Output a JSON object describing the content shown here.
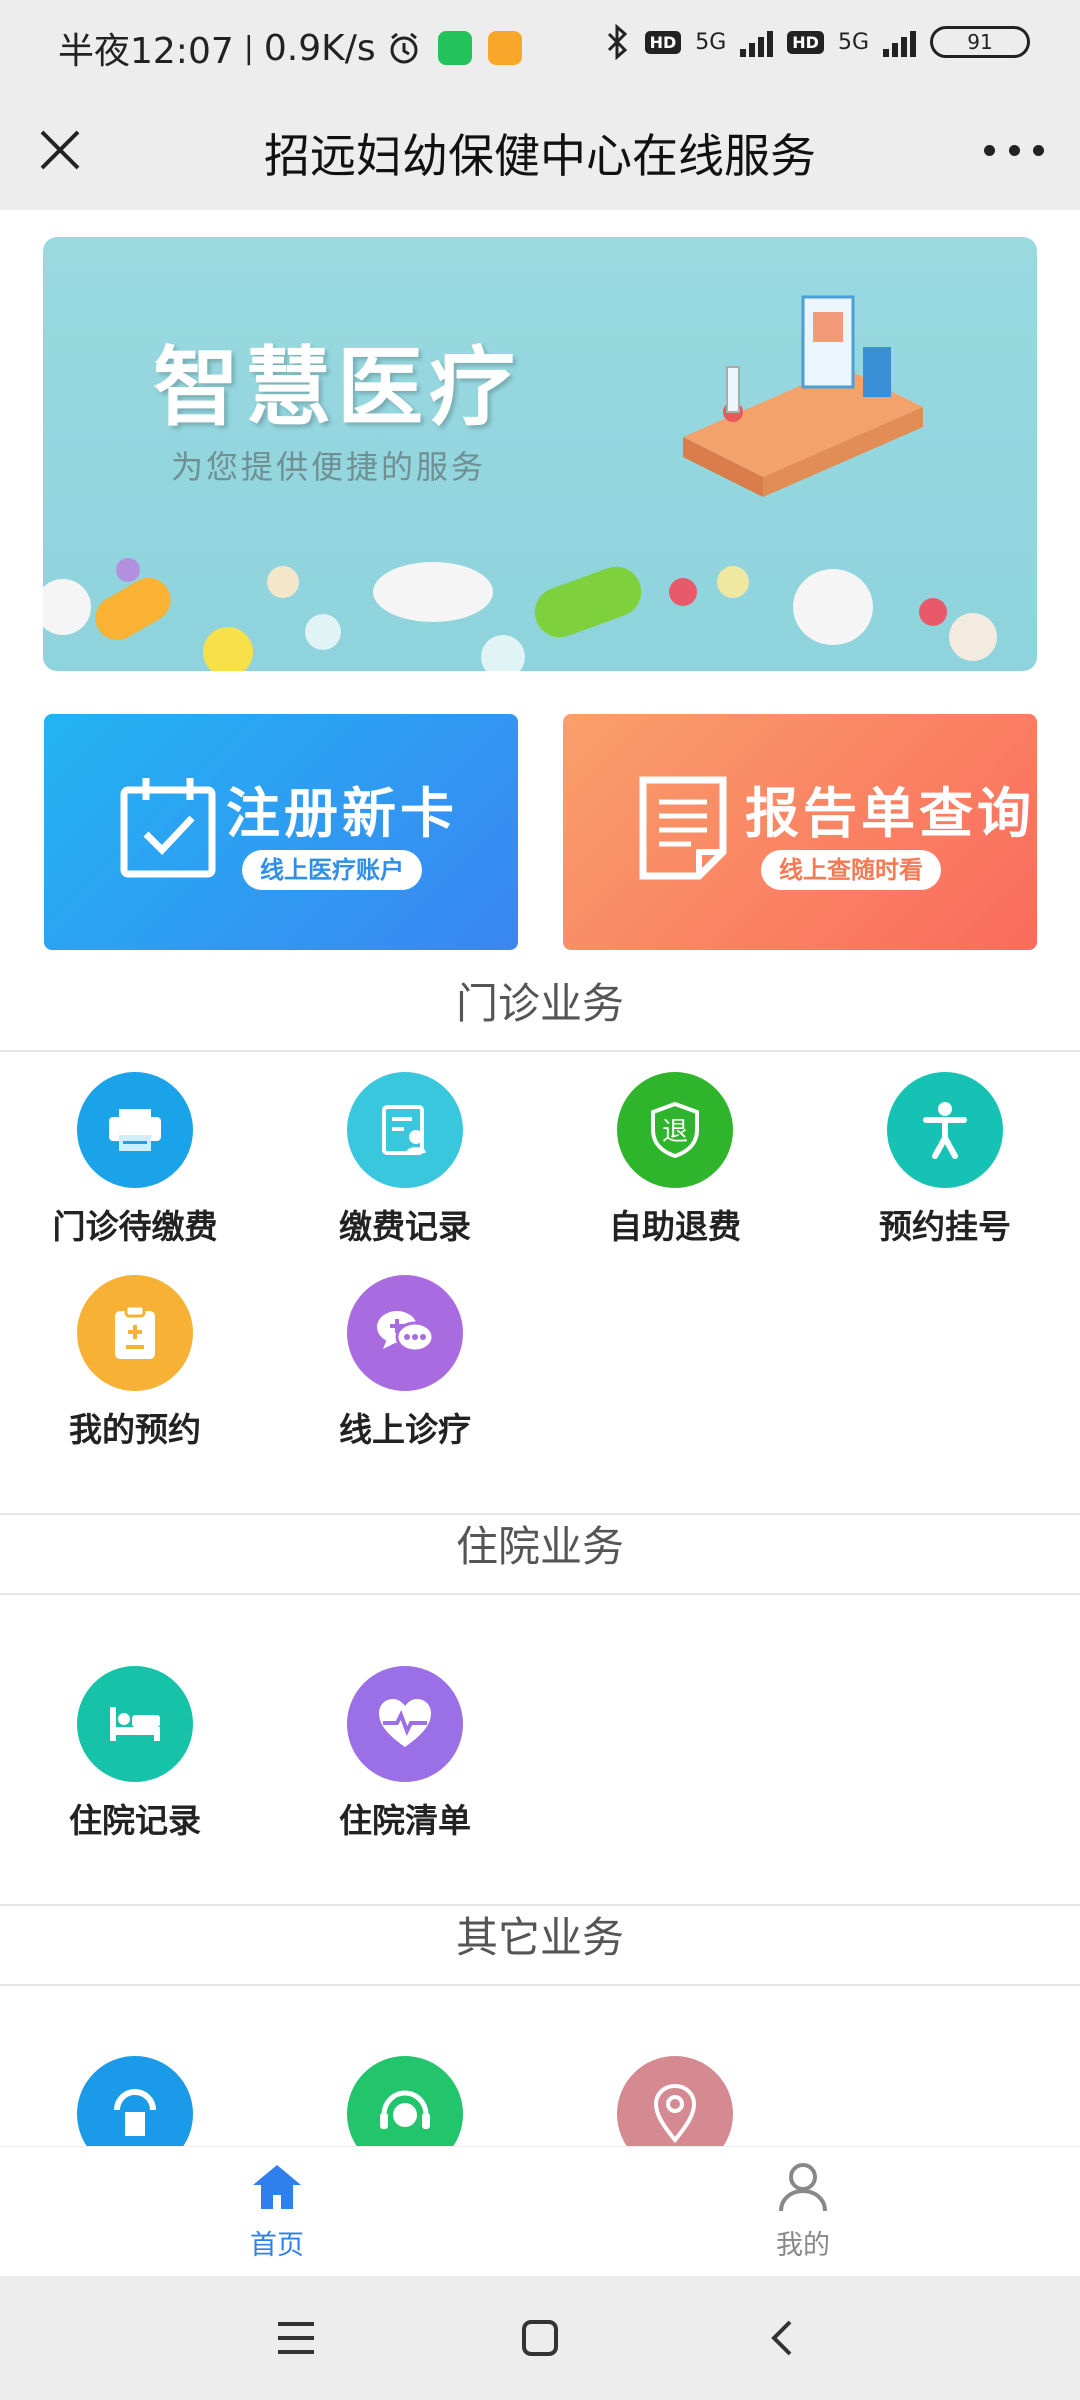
{
  "status_bar": {
    "time": "半夜12:07",
    "speed": "0.9K/s",
    "net1": "5G",
    "net2": "5G",
    "hd": "HD",
    "battery": "91"
  },
  "header": {
    "title": "招远妇幼保健中心在线服务"
  },
  "banner": {
    "title": "智慧医疗",
    "subtitle": "为您提供便捷的服务"
  },
  "cards": [
    {
      "title": "注册新卡",
      "pill": "线上医疗账户"
    },
    {
      "title": "报告单查询",
      "pill": "线上查随时看"
    }
  ],
  "outpatient": {
    "heading": "门诊业务",
    "items": [
      {
        "label": "门诊待缴费",
        "icon": "printer-icon",
        "color": "#1aa3e8"
      },
      {
        "label": "缴费记录",
        "icon": "record-icon",
        "color": "#39c7de"
      },
      {
        "label": "自助退费",
        "icon": "refund-shield-icon",
        "color": "#2fb52c"
      },
      {
        "label": "预约挂号",
        "icon": "person-icon",
        "color": "#16c2b3"
      },
      {
        "label": "我的预约",
        "icon": "clipboard-icon",
        "color": "#f7b134"
      },
      {
        "label": "线上诊疗",
        "icon": "chat-bubble-icon",
        "color": "#a96be0"
      }
    ]
  },
  "inpatient": {
    "heading": "住院业务",
    "items": [
      {
        "label": "住院记录",
        "icon": "bed-icon",
        "color": "#16c2a8"
      },
      {
        "label": "住院清单",
        "icon": "heart-pulse-icon",
        "color": "#9b6fe6"
      }
    ]
  },
  "other": {
    "heading": "其它业务",
    "items": [
      {
        "icon": "seat-icon",
        "color": "#1a9ae8"
      },
      {
        "icon": "headset-icon",
        "color": "#22c56b"
      },
      {
        "icon": "location-pin-icon",
        "color": "#d48a90"
      }
    ]
  },
  "tabbar": {
    "home": "首页",
    "mine": "我的",
    "active_color": "#2f80ed"
  }
}
